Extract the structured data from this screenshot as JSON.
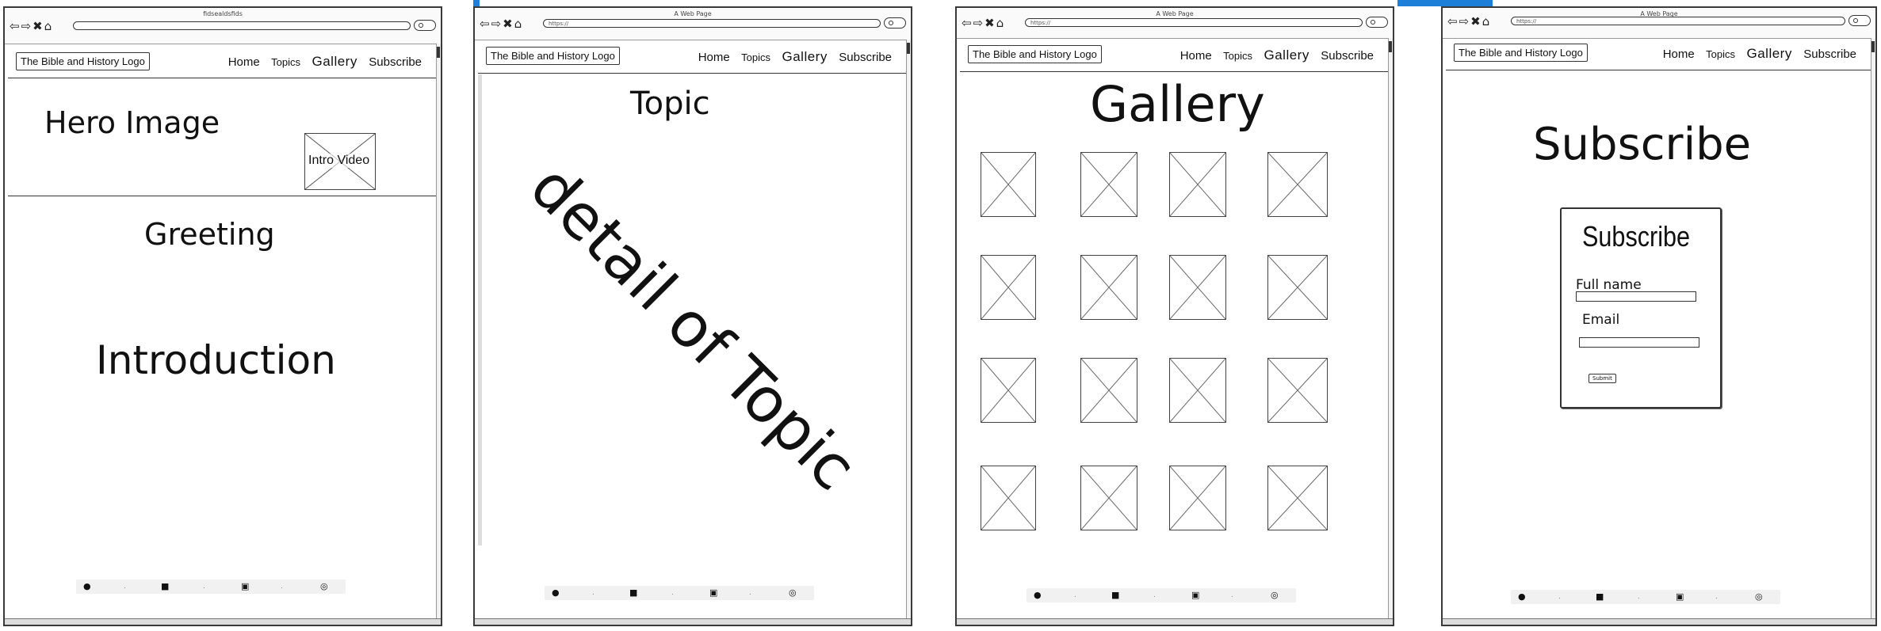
{
  "brand_color": "#1e7fd8",
  "header": {
    "logo": "The Bible and History Logo",
    "nav": {
      "home": "Home",
      "topics": "Topics",
      "gallery": "Gallery",
      "subscribe": "Subscribe"
    }
  },
  "footer_icons": [
    "facebook-icon",
    "twitter-icon",
    "youtube-icon",
    "instagram-icon"
  ],
  "frames": {
    "home": {
      "window_title": "fidsealdsfids",
      "hero_title": "Hero Image",
      "video_label": "Intro Video",
      "greeting": "Greeting",
      "introduction": "Introduction"
    },
    "topic": {
      "window_title": "A Web Page",
      "url": "https://",
      "heading": "Topic",
      "detail": "detail of Topic"
    },
    "gallery": {
      "window_title": "A Web Page",
      "url": "https://",
      "heading": "Gallery",
      "grid_rows": 4,
      "grid_cols": 4
    },
    "subscribe": {
      "window_title": "A Web Page",
      "url": "https://",
      "heading": "Subscribe",
      "form_title": "Subscribe",
      "full_name_label": "Full name",
      "email_label": "Email",
      "submit_label": "Submit"
    }
  }
}
